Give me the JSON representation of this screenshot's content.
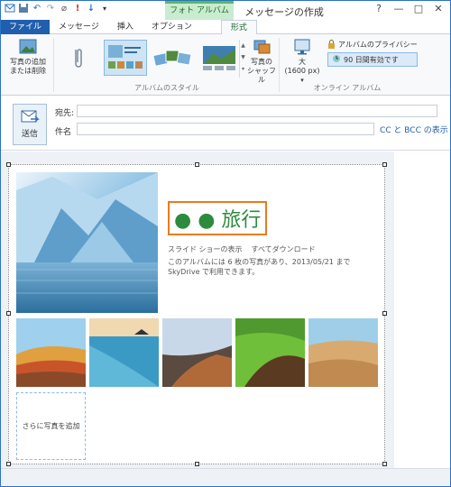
{
  "window": {
    "title": "メッセージの作成",
    "contextual_tab_header": "フォト アルバム ツール"
  },
  "tabs": [
    {
      "label": "ファイル"
    },
    {
      "label": "メッセージ"
    },
    {
      "label": "挿入"
    },
    {
      "label": "オプション"
    },
    {
      "label": "形式"
    }
  ],
  "ribbon": {
    "add_remove_label_1": "写真の追加",
    "add_remove_label_2": "または削除",
    "album_style_group": "アルバムのスタイル",
    "shuffle_label_1": "写真の",
    "shuffle_label_2": "シャッフル",
    "size_label_1": "大",
    "size_label_2": "(1600 px)",
    "privacy_label": "アルバムのプライバシー",
    "days_label": "90 日間有効です",
    "online_album_group": "オンライン アルバム"
  },
  "header": {
    "send_label": "送信",
    "to_label": "宛先:",
    "subject_label": "件名",
    "to_value": "",
    "subject_value": "",
    "cc_bcc_link": "CC と BCC の表示"
  },
  "album": {
    "title": "● ● 旅行",
    "slideshow_link": "スライド ショーの表示",
    "download_link": "すべてダウンロード",
    "description": "このアルバムには 6 枚の写真があり、2013/05/21 まで SkyDrive で利用できます。",
    "add_more_label": "さらに写真を追加"
  },
  "colors": {
    "title_green": "#2e8b3d",
    "selection_orange": "#e87c1e",
    "file_tab_blue": "#1f5fad"
  }
}
